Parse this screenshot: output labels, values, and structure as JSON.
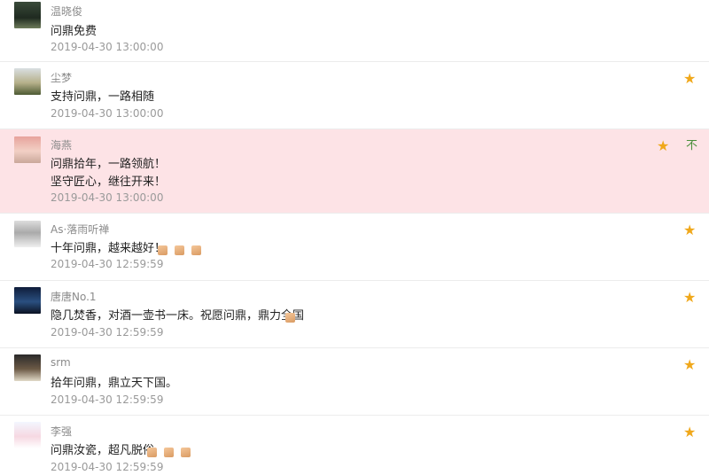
{
  "comments": [
    {
      "name": "温晓俊",
      "lines": [
        "问鼎免费"
      ],
      "time": "2019-04-30 13:00:00"
    },
    {
      "name": "尘梦",
      "lines": [
        "支持问鼎，一路相随"
      ],
      "time": "2019-04-30 13:00:00",
      "starred": true
    },
    {
      "name": "海燕",
      "lines": [
        "问鼎拾年，一路领航！",
        "坚守匠心，继往开来！"
      ],
      "time": "2019-04-30 13:00:00",
      "starred": true,
      "down_glyph": "不"
    },
    {
      "name": "As·落雨听禅",
      "lines": [
        "十年问鼎，越来越好！"
      ],
      "time": "2019-04-30 12:59:59",
      "starred": true
    },
    {
      "name": "唐唐No.1",
      "lines": [
        "隐几焚香，对酒一壶书一床。祝愿问鼎，鼎力全国"
      ],
      "time": "2019-04-30 12:59:59",
      "starred": true
    },
    {
      "name": "srm",
      "lines": [
        "拾年问鼎，鼎立天下国。"
      ],
      "time": "2019-04-30 12:59:59",
      "starred": true
    },
    {
      "name": "李强",
      "lines": [
        "问鼎汝瓷，超凡脱俗"
      ],
      "time": "2019-04-30 12:59:59",
      "starred": true
    }
  ],
  "icons": {
    "star": "star-icon",
    "thumb": "thumbs-up-icon",
    "down": "down-icon"
  },
  "colors": {
    "highlight": "#fde3e6",
    "star": "#f0a81b",
    "name": "#8b8b8b",
    "time": "#9a9a9a"
  }
}
